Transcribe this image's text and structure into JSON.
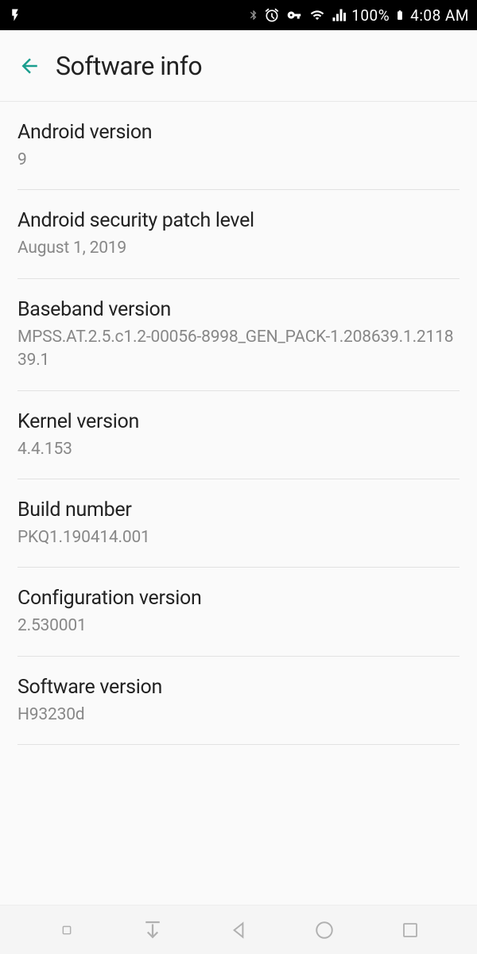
{
  "statusBar": {
    "batteryPercent": "100%",
    "time": "4:08 AM"
  },
  "header": {
    "title": "Software info"
  },
  "items": [
    {
      "title": "Android version",
      "value": "9"
    },
    {
      "title": "Android security patch level",
      "value": "August 1, 2019"
    },
    {
      "title": "Baseband version",
      "value": "MPSS.AT.2.5.c1.2-00056-8998_GEN_PACK-1.208639.1.211839.1"
    },
    {
      "title": "Kernel version",
      "value": "4.4.153"
    },
    {
      "title": "Build number",
      "value": "PKQ1.190414.001"
    },
    {
      "title": "Configuration version",
      "value": "2.530001"
    },
    {
      "title": "Software version",
      "value": "H93230d"
    }
  ]
}
